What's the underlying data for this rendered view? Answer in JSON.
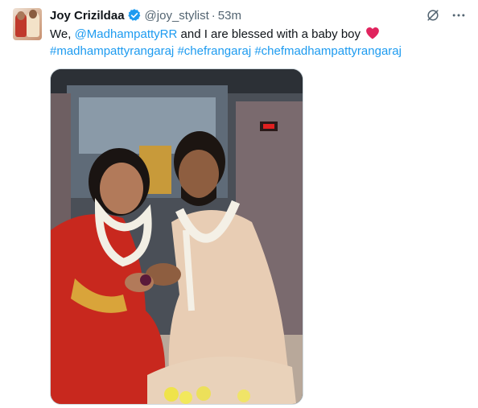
{
  "tweet": {
    "author": {
      "display_name": "Joy Crizildaa",
      "handle": "@joy_stylist",
      "verified": true,
      "avatar_icon": "profile-photo-couple"
    },
    "separator": "·",
    "timestamp": "53m",
    "text": {
      "prefix": "We, ",
      "mention": "@MadhampattyRR",
      "body": " and I are blessed with a baby boy",
      "emoji": "red-heart",
      "hashtags": [
        "#madhampattyrangaraj",
        "#chefrangaraj",
        "#chefmadhampattyrangaraj"
      ]
    },
    "media": {
      "type": "photo",
      "subject": "wedding-couple-photo"
    },
    "actions": {
      "grok_icon": "grok-icon",
      "more_icon": "more-icon"
    }
  },
  "colors": {
    "link": "#1d9bf0",
    "verified": "#1d9bf0",
    "secondary_text": "#536471",
    "heart": "#e0245e"
  }
}
